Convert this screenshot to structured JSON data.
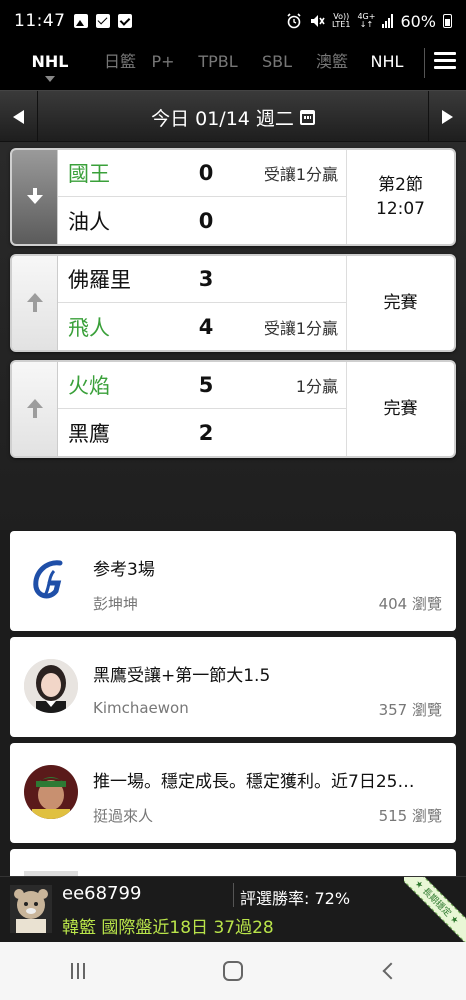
{
  "status_bar": {
    "time": "11:47",
    "volte_top": "Vo))",
    "volte_bottom": "LTE1",
    "network_top": "4G+",
    "network_bottom": "↓↑",
    "battery": "60%"
  },
  "tabs": [
    {
      "label": "NHL",
      "active": true
    },
    {
      "label": "日籃",
      "active": false
    },
    {
      "label": "P+",
      "active": false
    },
    {
      "label": "TPBL",
      "active": false
    },
    {
      "label": "SBL",
      "active": false
    },
    {
      "label": "澳籃",
      "active": false
    },
    {
      "label": "NHL",
      "active": false
    }
  ],
  "date_bar": {
    "label": "今日 01/14 週二"
  },
  "games": [
    {
      "home_team": "國王",
      "home_score": "0",
      "home_note": "受讓1分贏",
      "away_team": "油人",
      "away_score": "0",
      "away_note": "",
      "status_line1": "第2節",
      "status_line2": "12:07",
      "trend": "down"
    },
    {
      "home_team": "佛羅里",
      "home_score": "3",
      "home_note": "",
      "away_team": "飛人",
      "away_score": "4",
      "away_note": "受讓1分贏",
      "status_line1": "完賽",
      "status_line2": "",
      "trend": "up"
    },
    {
      "home_team": "火焰",
      "home_score": "5",
      "home_note": "1分贏",
      "away_team": "黑鷹",
      "away_score": "2",
      "away_note": "",
      "status_line1": "完賽",
      "status_line2": "",
      "trend": "up"
    }
  ],
  "posts": [
    {
      "title": "参考3場",
      "author": "彭坤坤",
      "views": "404 瀏覽",
      "avatar": "logo-g"
    },
    {
      "title": "黑鷹受讓+第一節大1.5",
      "author": "Kimchaewon",
      "views": "357 瀏覽",
      "avatar": "girl-photo"
    },
    {
      "title": "推一場。穩定成長。穩定獲利。近7日25…",
      "author": "挺過來人",
      "views": "515 瀏覽",
      "avatar": "man-photo"
    }
  ],
  "promo": {
    "username": "ee68799",
    "win_rate": "評選勝率: 72%",
    "record": "韓籃 國際盤近18日 37過28",
    "ribbon": "★ 長期穩定 ★"
  },
  "colors": {
    "green_team": "#3aa03a",
    "promo_text": "#b9e44a",
    "tab_bg": "#000000"
  }
}
